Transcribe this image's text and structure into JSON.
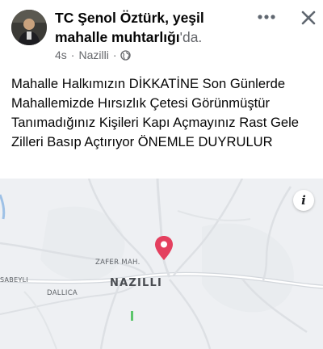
{
  "post": {
    "author_name": "TC Şenol Öztürk, yeşil mahalle muhtarlığı",
    "author_suffix": "'da.",
    "time": "4s",
    "separator": "·",
    "location": "Nazilli",
    "privacy_icon": "globe-icon",
    "more_icon": "more-horizontal-icon",
    "close_icon": "close-icon",
    "body": "Mahalle Halkımızın DİKKATİNE  Son Günlerde Mahallemizde Hırsızlık Çetesi Görünmüştür Tanımadığınız Kişileri Kapı Açmayınız Rast Gele Zilleri Basıp Açtırıyor  ÖNEMLE DUYRULUR"
  },
  "map": {
    "city_label": "NAZILLI",
    "labels": {
      "zafer": "ZAFER MAH.",
      "sabeyli": "SABEYLI",
      "dallica": "DALLICA"
    },
    "info_label": "i",
    "pin_icon": "location-pin-icon",
    "pin_color": "#e4405f"
  }
}
